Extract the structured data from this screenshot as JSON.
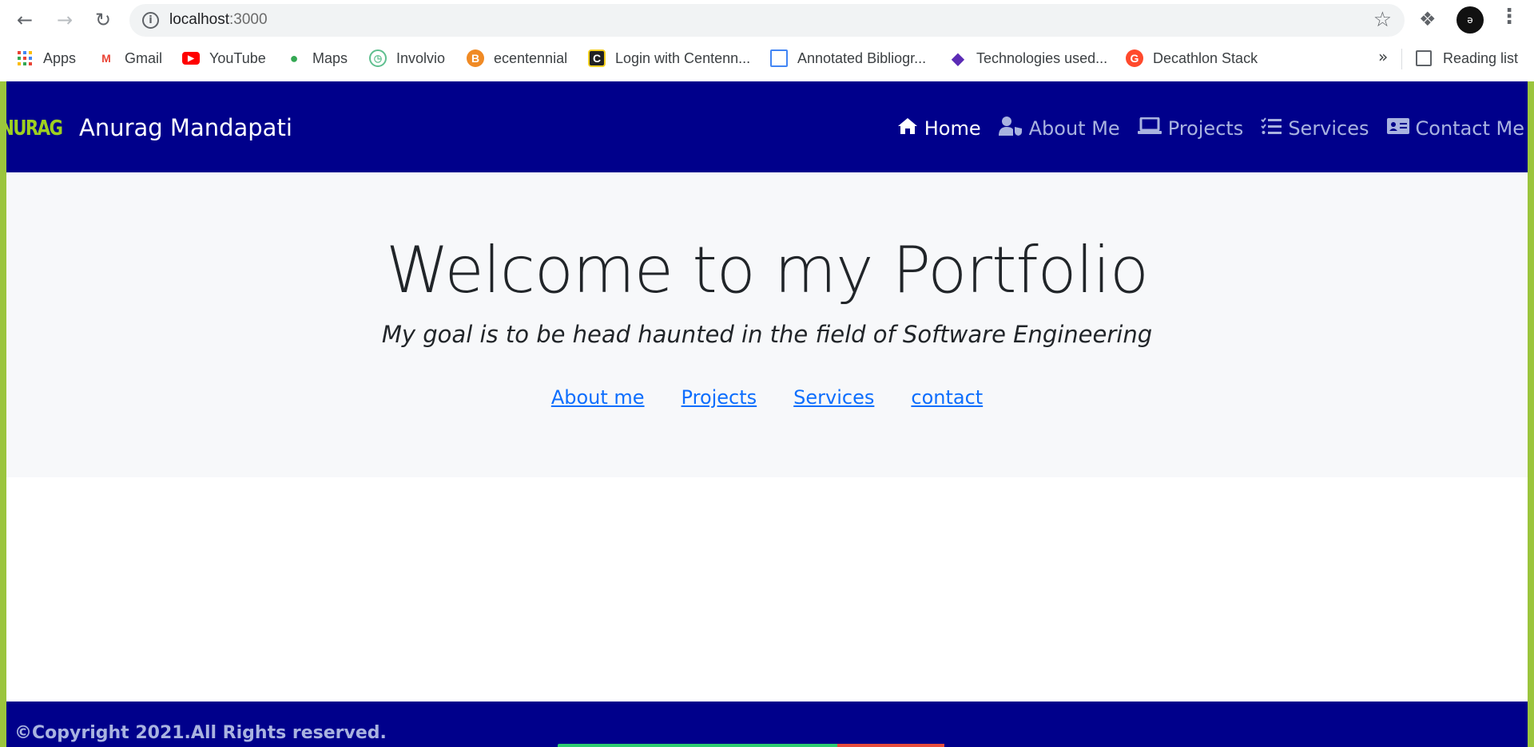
{
  "browser": {
    "url_host": "localhost",
    "url_port": ":3000",
    "bookmarks": [
      {
        "label": "Apps",
        "icon": "apps-grid-icon",
        "color": "#ea4335"
      },
      {
        "label": "Gmail",
        "icon": "gmail-icon",
        "color": "#ea4335"
      },
      {
        "label": "YouTube",
        "icon": "youtube-icon",
        "color": "#ff0000"
      },
      {
        "label": "Maps",
        "icon": "maps-pin-icon",
        "color": "#34a853"
      },
      {
        "label": "Involvio",
        "icon": "involvio-clock-icon",
        "color": "#5fbf8f"
      },
      {
        "label": "ecentennial",
        "icon": "ecentennial-icon",
        "color": "#f08a24"
      },
      {
        "label": "Login with Centenn...",
        "icon": "centennial-c-icon",
        "color": "#222222"
      },
      {
        "label": "Annotated Bibliogr...",
        "icon": "layout-icon",
        "color": "#4285f4"
      },
      {
        "label": "Technologies used...",
        "icon": "stack-diamond-icon",
        "color": "#5b2bb5"
      },
      {
        "label": "Decathlon Stack",
        "icon": "g2-icon",
        "color": "#ff492c"
      }
    ],
    "more_label": "»",
    "reading_list_label": "Reading list",
    "avatar_text": "ə"
  },
  "navbar": {
    "logo_text": "NURAG",
    "brand": "Anurag Mandapati",
    "links": [
      {
        "label": "Home",
        "icon": "home-icon",
        "active": true
      },
      {
        "label": "About Me",
        "icon": "user-shield-icon",
        "active": false
      },
      {
        "label": "Projects",
        "icon": "laptop-icon",
        "active": false
      },
      {
        "label": "Services",
        "icon": "tasks-icon",
        "active": false
      },
      {
        "label": "Contact Me",
        "icon": "id-card-icon",
        "active": false
      }
    ]
  },
  "hero": {
    "title": "Welcome to my Portfolio",
    "subtitle": "My goal is to be head haunted in the field of Software Engineering",
    "links": [
      "About me",
      "Projects",
      "Services",
      "contact"
    ]
  },
  "footer": {
    "text": "©Copyright 2021.All Rights reserved."
  },
  "colors": {
    "navbar_bg": "#00008b",
    "nav_inactive": "#a9b3e0",
    "link_blue": "#0d6efd",
    "hero_bg": "#f7f8fa",
    "frame_green": "#9bc53d"
  }
}
